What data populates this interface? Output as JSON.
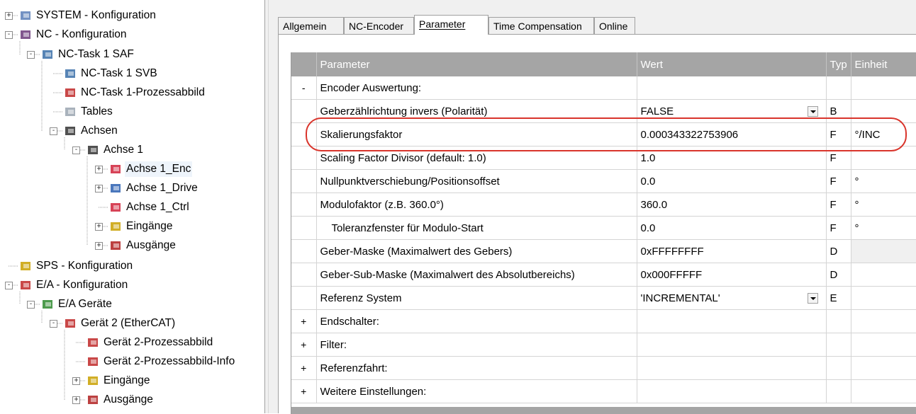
{
  "tree": {
    "nodes": [
      {
        "label": "SYSTEM - Konfiguration",
        "icon": "system-config-icon",
        "expand": "+"
      },
      {
        "label": "NC - Konfiguration",
        "icon": "nc-config-icon",
        "expand": "-"
      },
      {
        "label": "NC-Task 1 SAF",
        "icon": "task-icon",
        "expand": "-"
      },
      {
        "label": "NC-Task 1 SVB",
        "icon": "task-icon",
        "expand": ""
      },
      {
        "label": "NC-Task 1-Prozessabbild",
        "icon": "process-image-icon",
        "expand": ""
      },
      {
        "label": "Tables",
        "icon": "table-icon",
        "expand": ""
      },
      {
        "label": "Achsen",
        "icon": "axes-icon",
        "expand": "-"
      },
      {
        "label": "Achse 1",
        "icon": "axis-icon",
        "expand": "-"
      },
      {
        "label": "Achse 1_Enc",
        "icon": "encoder-icon",
        "expand": "+",
        "selected": true
      },
      {
        "label": "Achse 1_Drive",
        "icon": "drive-icon",
        "expand": "+"
      },
      {
        "label": "Achse 1_Ctrl",
        "icon": "controller-icon",
        "expand": ""
      },
      {
        "label": "Eingänge",
        "icon": "inputs-icon",
        "expand": "+"
      },
      {
        "label": "Ausgänge",
        "icon": "outputs-icon",
        "expand": "+"
      },
      {
        "label": "SPS - Konfiguration",
        "icon": "plc-config-icon",
        "expand": ""
      },
      {
        "label": "E/A - Konfiguration",
        "icon": "io-config-icon",
        "expand": "-"
      },
      {
        "label": "E/A Geräte",
        "icon": "io-devices-icon",
        "expand": "-"
      },
      {
        "label": "Gerät 2 (EtherCAT)",
        "icon": "ethercat-icon",
        "expand": "-"
      },
      {
        "label": "Gerät 2-Prozessabbild",
        "icon": "process-image-icon",
        "expand": ""
      },
      {
        "label": "Gerät 2-Prozessabbild-Info",
        "icon": "process-image-icon",
        "expand": ""
      },
      {
        "label": "Eingänge",
        "icon": "inputs-icon",
        "expand": "+"
      },
      {
        "label": "Ausgänge",
        "icon": "outputs-icon",
        "expand": "+"
      }
    ]
  },
  "tabs": [
    {
      "label": "Allgemein"
    },
    {
      "label": "NC-Encoder"
    },
    {
      "label": "Parameter",
      "active": true
    },
    {
      "label": "Time Compensation"
    },
    {
      "label": "Online"
    }
  ],
  "grid": {
    "headers": {
      "toggle": "",
      "param": "Parameter",
      "value": "Wert",
      "type": "Typ",
      "unit": "Einheit"
    },
    "rows": [
      {
        "toggle": "-",
        "param": "Encoder Auswertung:",
        "value": "",
        "type": "",
        "unit": "",
        "group": true
      },
      {
        "toggle": "",
        "param": "Geberzählrichtung invers (Polarität)",
        "value": "FALSE",
        "type": "B",
        "unit": "",
        "dropdown": true
      },
      {
        "toggle": "",
        "param": "Skalierungsfaktor",
        "value": "0.000343322753906",
        "type": "F",
        "unit": "°/INC"
      },
      {
        "toggle": "",
        "param": "Scaling Factor Divisor (default: 1.0)",
        "value": "1.0",
        "type": "F",
        "unit": ""
      },
      {
        "toggle": "",
        "param": "Nullpunktverschiebung/Positionsoffset",
        "value": "0.0",
        "type": "F",
        "unit": "°"
      },
      {
        "toggle": "",
        "param": "Modulofaktor (z.B. 360.0°)",
        "value": "360.0",
        "type": "F",
        "unit": "°"
      },
      {
        "toggle": "",
        "param": "Toleranzfenster für Modulo-Start",
        "value": "0.0",
        "type": "F",
        "unit": "°",
        "indent": true
      },
      {
        "toggle": "",
        "param": "Geber-Maske (Maximalwert des Gebers)",
        "value": "0xFFFFFFFF",
        "type": "D",
        "unit": "",
        "greyUnit": true
      },
      {
        "toggle": "",
        "param": "Geber-Sub-Maske (Maximalwert des Absolutbereichs)",
        "value": "0x000FFFFF",
        "type": "D",
        "unit": ""
      },
      {
        "toggle": "",
        "param": "Referenz System",
        "value": "'INCREMENTAL'",
        "type": "E",
        "unit": "",
        "dropdown": true
      },
      {
        "toggle": "+",
        "param": "Endschalter:",
        "value": "",
        "type": "",
        "unit": "",
        "group": true
      },
      {
        "toggle": "+",
        "param": "Filter:",
        "value": "",
        "type": "",
        "unit": "",
        "group": true
      },
      {
        "toggle": "+",
        "param": "Referenzfahrt:",
        "value": "",
        "type": "",
        "unit": "",
        "group": true
      },
      {
        "toggle": "+",
        "param": "Weitere Einstellungen:",
        "value": "",
        "type": "",
        "unit": "",
        "group": true
      }
    ]
  },
  "colors": {
    "header_bg": "#a5a5a5",
    "highlight": "#d9342b",
    "selected_bg": "#eef4fb"
  }
}
